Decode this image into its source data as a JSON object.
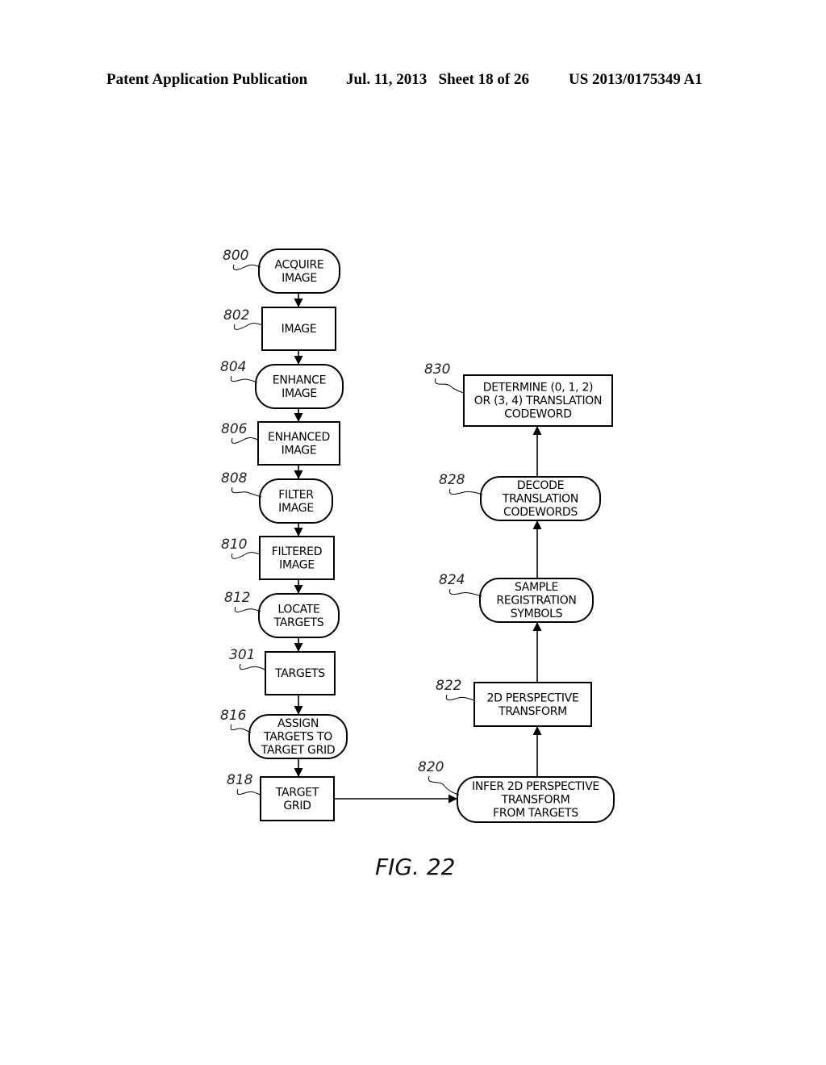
{
  "header": {
    "publication": "Patent Application Publication",
    "date_sheet": "Jul. 11, 2013   Sheet 18 of 26",
    "number": "US 2013/0175349 A1"
  },
  "figure": {
    "label": "FIG. 22"
  },
  "nodes": [
    {
      "id": "800",
      "shape": "rounded",
      "lines": [
        "ACQUIRE",
        "IMAGE"
      ]
    },
    {
      "id": "802",
      "shape": "rect",
      "lines": [
        "IMAGE"
      ]
    },
    {
      "id": "804",
      "shape": "rounded",
      "lines": [
        "ENHANCE",
        "IMAGE"
      ]
    },
    {
      "id": "806",
      "shape": "rect",
      "lines": [
        "ENHANCED",
        "IMAGE"
      ]
    },
    {
      "id": "808",
      "shape": "rounded",
      "lines": [
        "FILTER",
        "IMAGE"
      ]
    },
    {
      "id": "810",
      "shape": "rect",
      "lines": [
        "FILTERED",
        "IMAGE"
      ]
    },
    {
      "id": "812",
      "shape": "rounded",
      "lines": [
        "LOCATE",
        "TARGETS"
      ]
    },
    {
      "id": "301",
      "shape": "rect",
      "lines": [
        "TARGETS"
      ]
    },
    {
      "id": "816",
      "shape": "rounded",
      "lines": [
        "ASSIGN",
        "TARGETS TO",
        "TARGET GRID"
      ]
    },
    {
      "id": "818",
      "shape": "rect",
      "lines": [
        "TARGET",
        "GRID"
      ]
    },
    {
      "id": "820",
      "shape": "rounded",
      "lines": [
        "INFER 2D PERSPECTIVE",
        "TRANSFORM",
        "FROM TARGETS"
      ]
    },
    {
      "id": "822",
      "shape": "rect",
      "lines": [
        "2D PERSPECTIVE",
        "TRANSFORM"
      ]
    },
    {
      "id": "824",
      "shape": "rounded",
      "lines": [
        "SAMPLE",
        "REGISTRATION",
        "SYMBOLS"
      ]
    },
    {
      "id": "828",
      "shape": "rounded",
      "lines": [
        "DECODE",
        "TRANSLATION",
        "CODEWORDS"
      ]
    },
    {
      "id": "830",
      "shape": "rect",
      "lines": [
        "DETERMINE (0, 1, 2)",
        "OR (3, 4) TRANSLATION",
        "CODEWORD"
      ]
    }
  ],
  "edges": [
    {
      "from": "800",
      "to": "802"
    },
    {
      "from": "802",
      "to": "804"
    },
    {
      "from": "804",
      "to": "806"
    },
    {
      "from": "806",
      "to": "808"
    },
    {
      "from": "808",
      "to": "810"
    },
    {
      "from": "810",
      "to": "812"
    },
    {
      "from": "812",
      "to": "301"
    },
    {
      "from": "301",
      "to": "816"
    },
    {
      "from": "816",
      "to": "818"
    },
    {
      "from": "818",
      "to": "820"
    },
    {
      "from": "820",
      "to": "822"
    },
    {
      "from": "822",
      "to": "824"
    },
    {
      "from": "824",
      "to": "828"
    },
    {
      "from": "828",
      "to": "830"
    }
  ]
}
